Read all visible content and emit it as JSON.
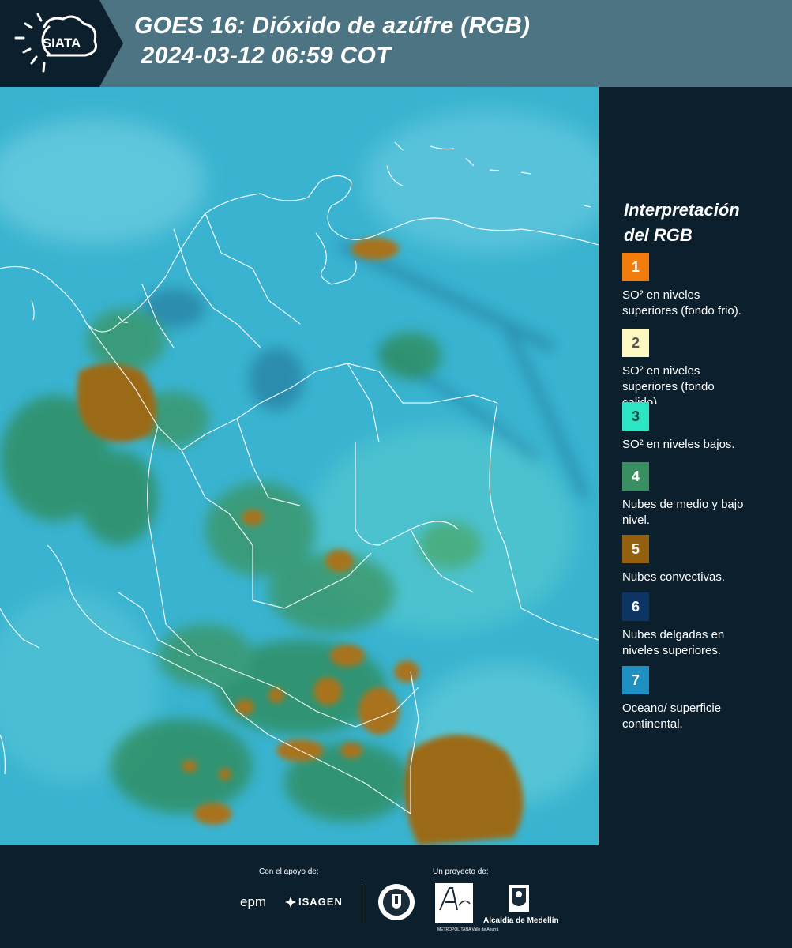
{
  "header": {
    "logo_text": "SIATA",
    "title_line1": "GOES 16: Dióxido de azúfre (RGB)",
    "title_line2": " 2024-03-12 06:59 COT"
  },
  "legend": {
    "title_line1": "Interpretación",
    "title_line2": "del RGB",
    "items": [
      {
        "number": "1",
        "color": "#f27c0c",
        "text_color": "#ffffff",
        "line1": "SO² en niveles",
        "line2": "superiores (fondo frio)."
      },
      {
        "number": "2",
        "color": "#fdf7c2",
        "text_color": "#555555",
        "line1": "SO² en niveles",
        "line2": "superiores (fondo",
        "line3": "calido)."
      },
      {
        "number": "3",
        "color": "#2be5c5",
        "text_color": "#0b4b44",
        "line1": "SO² en niveles bajos."
      },
      {
        "number": "4",
        "color": "#3a8f62",
        "text_color": "#ffffff",
        "line1": "Nubes de medio y bajo",
        "line2": "nivel."
      },
      {
        "number": "5",
        "color": "#93600f",
        "text_color": "#ffffff",
        "line1": "Nubes convectivas."
      },
      {
        "number": "6",
        "color": "#0d3563",
        "text_color": "#ffffff",
        "line1": "Nubes delgadas en",
        "line2": "niveles superiores."
      },
      {
        "number": "7",
        "color": "#1d8fc0",
        "text_color": "#ffffff",
        "line1": "Oceano/ superficie",
        "line2": "continental."
      }
    ]
  },
  "footer": {
    "support_label": "Con el apoyo de:",
    "project_label": "Un proyecto de:",
    "sponsor1": "epm",
    "sponsor2": "ISAGEN",
    "partner1_top": "Área",
    "partner1_line1": "METROPOLITANA",
    "partner1_line2": "Valle de Aburrá",
    "partner2": "Alcaldía de Medellín"
  },
  "map": {
    "description_colors": {
      "ocean": "#39b3d0",
      "low_cloud": "#2f8a57",
      "convective": "#9b6a19"
    }
  }
}
